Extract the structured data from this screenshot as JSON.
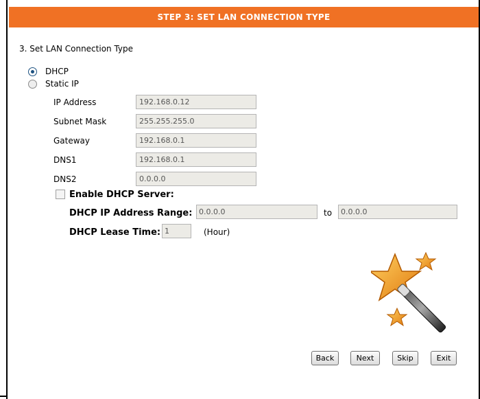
{
  "header": {
    "title": "STEP 3: SET LAN CONNECTION TYPE"
  },
  "section": {
    "title": "3. Set LAN Connection Type"
  },
  "connection": {
    "options": [
      {
        "label": "DHCP",
        "selected": true
      },
      {
        "label": "Static IP",
        "selected": false
      }
    ]
  },
  "fields": {
    "ip_address": {
      "label": "IP Address",
      "value": "192.168.0.12"
    },
    "subnet_mask": {
      "label": "Subnet Mask",
      "value": "255.255.255.0"
    },
    "gateway": {
      "label": "Gateway",
      "value": "192.168.0.1"
    },
    "dns1": {
      "label": "DNS1",
      "value": "192.168.0.1"
    },
    "dns2": {
      "label": "DNS2",
      "value": "0.0.0.0"
    }
  },
  "dhcp_server": {
    "enable_label": "Enable DHCP Server:",
    "enabled": false,
    "range_label": "DHCP IP Address Range:",
    "range_start": "0.0.0.0",
    "range_to": "to",
    "range_end": "0.0.0.0",
    "lease_label": "DHCP Lease Time:",
    "lease_value": "1",
    "lease_unit": "(Hour)"
  },
  "buttons": {
    "back": "Back",
    "next": "Next",
    "skip": "Skip",
    "exit": "Exit"
  },
  "colors": {
    "header_bg": "#f07124",
    "field_bg": "#ecebe6",
    "star": "#f5a623"
  },
  "icons": {
    "wizard": "magic-wand-stars-icon"
  }
}
